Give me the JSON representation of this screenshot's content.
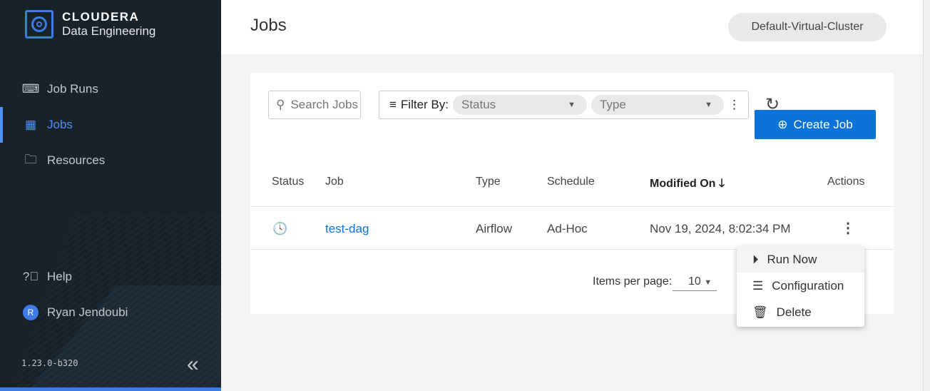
{
  "brand": {
    "name": "CLOUDERA",
    "product": "Data Engineering"
  },
  "sidebar": {
    "items": [
      {
        "label": "Job Runs"
      },
      {
        "label": "Jobs"
      },
      {
        "label": "Resources"
      }
    ],
    "help": "Help",
    "user": "Ryan Jendoubi",
    "user_initial": "R",
    "version": "1.23.0-b320"
  },
  "header": {
    "title": "Jobs",
    "cluster": "Default-Virtual-Cluster"
  },
  "toolbar": {
    "search_placeholder": "Search Jobs",
    "filter_label": "Filter By:",
    "status_placeholder": "Status",
    "type_placeholder": "Type",
    "create_label": "Create Job"
  },
  "table": {
    "headers": [
      "Status",
      "Job",
      "Type",
      "Schedule",
      "Modified On",
      "Actions"
    ],
    "rows": [
      {
        "job": "test-dag",
        "type": "Airflow",
        "schedule": "Ad-Hoc",
        "modified": "Nov 19, 2024, 8:02:34 PM"
      }
    ]
  },
  "pagination": {
    "label": "Items per page:",
    "value": "10"
  },
  "menu": {
    "items": [
      "Run Now",
      "Configuration",
      "Delete"
    ]
  },
  "colors": {
    "accent": "#0a73d9",
    "sidebar": "#17222b",
    "active": "#4f8ff7"
  }
}
